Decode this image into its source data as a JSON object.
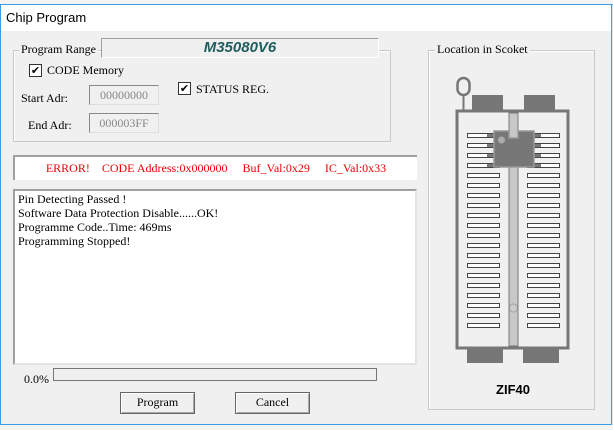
{
  "window": {
    "title": "Chip Program"
  },
  "program_range": {
    "label": "Program Range",
    "chip_name": "M35080V6",
    "code_memory": {
      "label": "CODE Memory",
      "checked": true
    },
    "status_reg": {
      "label": "STATUS REG.",
      "checked": true
    },
    "start_adr": {
      "label": "Start Adr:",
      "value": "00000000"
    },
    "end_adr": {
      "label": "End Adr:",
      "value": "000003FF"
    }
  },
  "error_line": "ERROR!    CODE Address:0x000000     Buf_Val:0x29     IC_Val:0x33",
  "log": [
    "Pin Detecting Passed !",
    "Software Data Protection Disable......OK!",
    "Programme Code..Time: 469ms",
    "Programming Stopped!"
  ],
  "progress": {
    "label": "0.0%",
    "percent": 0
  },
  "buttons": {
    "program": "Program",
    "cancel": "Cancel"
  },
  "socket": {
    "label": "Location in Scoket",
    "type": "ZIF40",
    "pins_per_side": 20,
    "chip_pins_per_side": 4
  },
  "colors": {
    "error": "#ee0000",
    "chip_name": "#1e5e5e",
    "socket": "#777777"
  }
}
